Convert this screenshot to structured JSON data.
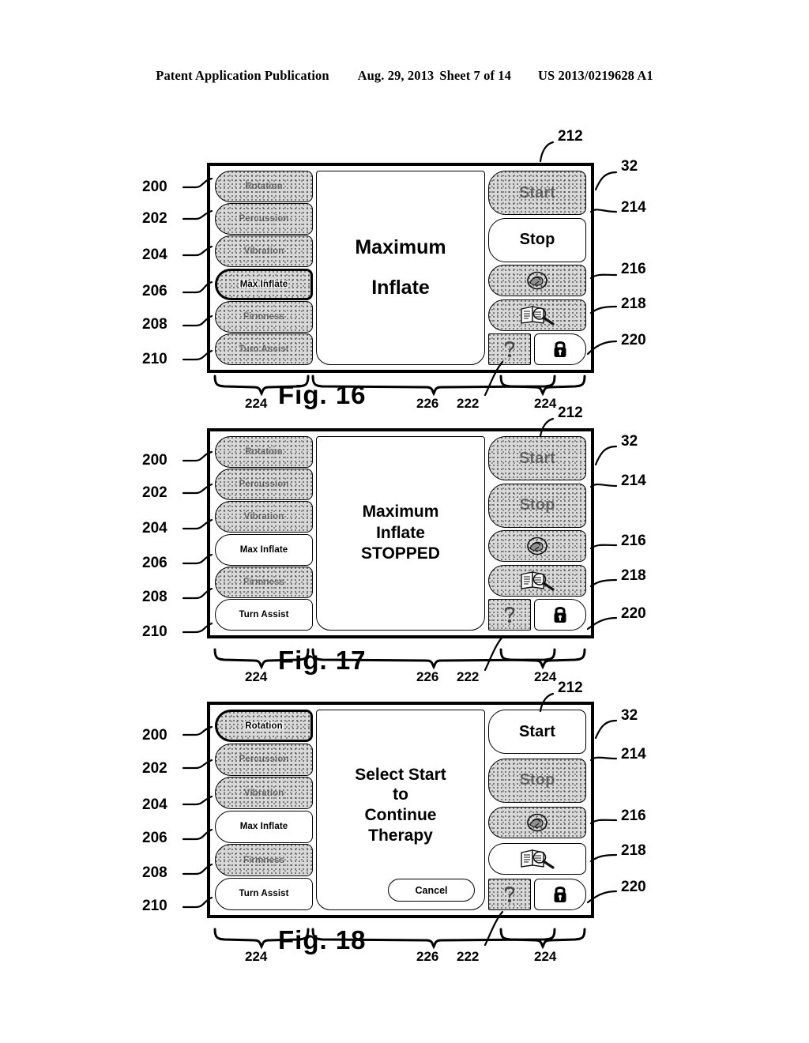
{
  "header": {
    "left": "Patent Application Publication",
    "date": "Aug. 29, 2013",
    "sheet": "Sheet 7 of 14",
    "pub_number": "US 2013/0219628 A1"
  },
  "menu_labels": {
    "rotation": "Rotation",
    "percussion": "Percussion",
    "vibration": "Vibration",
    "max_inflate": "Max Inflate",
    "firmness": "Firmness",
    "turn_assist": "Turn Assist",
    "start": "Start",
    "stop": "Stop",
    "cancel": "Cancel"
  },
  "icon_names": {
    "patient_position": "patient-position-icon",
    "manual": "manual-magnifier-icon",
    "help": "help-icon",
    "lock": "lock-icon"
  },
  "refs": {
    "r200": "200",
    "r202": "202",
    "r204": "204",
    "r206": "206",
    "r208": "208",
    "r210": "210",
    "r212": "212",
    "r214": "214",
    "r216": "216",
    "r218": "218",
    "r220": "220",
    "r222": "222",
    "r224": "224",
    "r226": "226",
    "r32": "32"
  },
  "figures": [
    {
      "id": "fig16",
      "caption": "Fig. 16",
      "display_lines": [
        "Maximum",
        "Inflate"
      ],
      "has_cancel": false,
      "left_states": {
        "rotation": "disabled",
        "percussion": "disabled",
        "vibration": "disabled",
        "max_inflate": "selected",
        "firmness": "disabled",
        "turn_assist": "disabled"
      },
      "right_states": {
        "start": "disabled",
        "stop": "enabled",
        "patient_position": "disabled",
        "manual": "disabled",
        "help": "disabled",
        "lock": "enabled"
      }
    },
    {
      "id": "fig17",
      "caption": "Fig. 17",
      "display_lines": [
        "Maximum",
        "Inflate",
        "STOPPED"
      ],
      "has_cancel": false,
      "left_states": {
        "rotation": "disabled",
        "percussion": "disabled",
        "vibration": "disabled",
        "max_inflate": "enabled",
        "firmness": "disabled",
        "turn_assist": "enabled"
      },
      "right_states": {
        "start": "disabled",
        "stop": "disabled",
        "patient_position": "disabled",
        "manual": "disabled",
        "help": "disabled",
        "lock": "enabled"
      }
    },
    {
      "id": "fig18",
      "caption": "Fig. 18",
      "display_lines": [
        "Select Start",
        "to",
        "Continue",
        "Therapy"
      ],
      "has_cancel": true,
      "left_states": {
        "rotation": "selected",
        "percussion": "disabled",
        "vibration": "disabled",
        "max_inflate": "enabled",
        "firmness": "disabled",
        "turn_assist": "enabled"
      },
      "right_states": {
        "start": "enabled",
        "stop": "disabled",
        "patient_position": "disabled",
        "manual": "enabled",
        "help": "disabled",
        "lock": "enabled"
      }
    }
  ]
}
